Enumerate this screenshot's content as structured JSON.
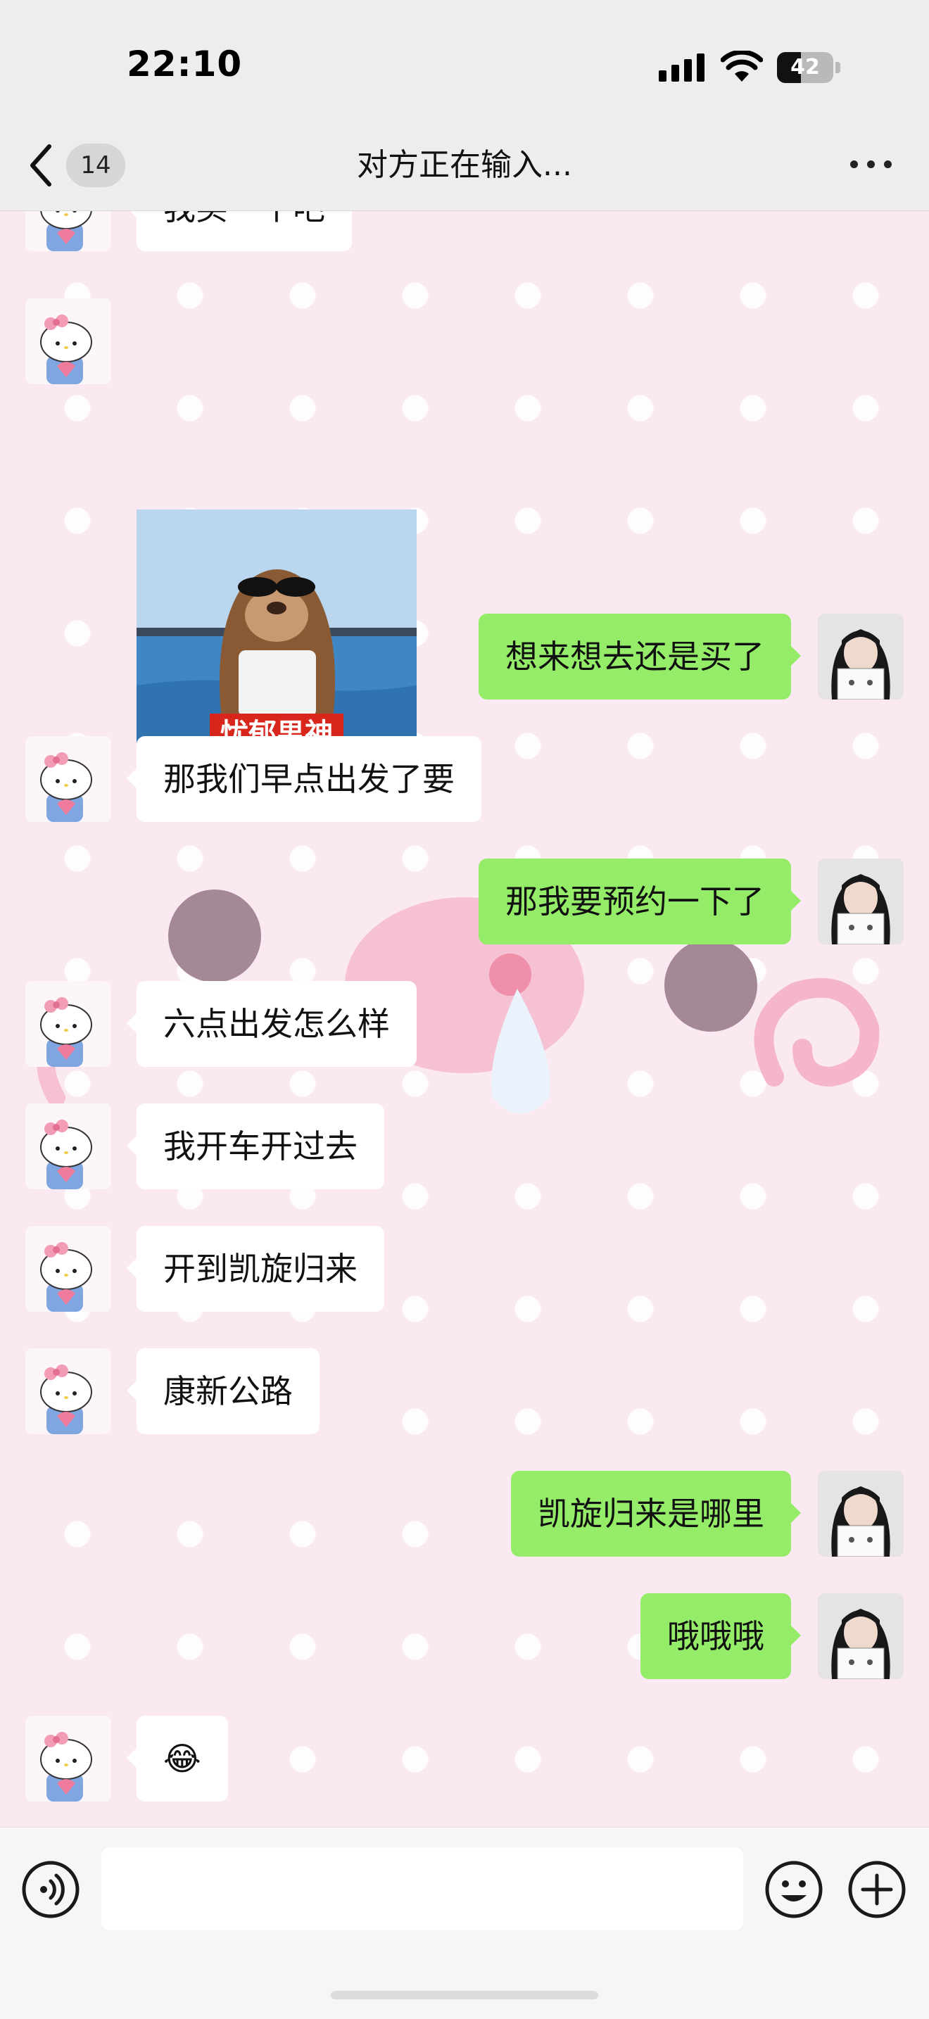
{
  "status_bar": {
    "time": "22:10",
    "battery_level": "42",
    "battery_fill": 0.42
  },
  "nav": {
    "unread_count": "14",
    "title": "对方正在输入..."
  },
  "sticker": {
    "caption": "忧郁男神"
  },
  "messages": [
    {
      "side": "in",
      "kind": "text",
      "text": "我买一个吧"
    },
    {
      "side": "in",
      "kind": "sticker",
      "text": ""
    },
    {
      "side": "out",
      "kind": "text",
      "text": "想来想去还是买了"
    },
    {
      "side": "in",
      "kind": "text",
      "text": "那我们早点出发了要"
    },
    {
      "side": "out",
      "kind": "text",
      "text": "那我要预约一下了"
    },
    {
      "side": "in",
      "kind": "text",
      "text": "六点出发怎么样"
    },
    {
      "side": "in",
      "kind": "text",
      "text": "我开车开过去"
    },
    {
      "side": "in",
      "kind": "text",
      "text": "开到凯旋归来"
    },
    {
      "side": "in",
      "kind": "text",
      "text": "康新公路"
    },
    {
      "side": "out",
      "kind": "text",
      "text": "凯旋归来是哪里"
    },
    {
      "side": "out",
      "kind": "text",
      "text": "哦哦哦"
    },
    {
      "side": "in",
      "kind": "emoji",
      "text": "😂"
    }
  ],
  "input_bar": {
    "draft": ""
  }
}
